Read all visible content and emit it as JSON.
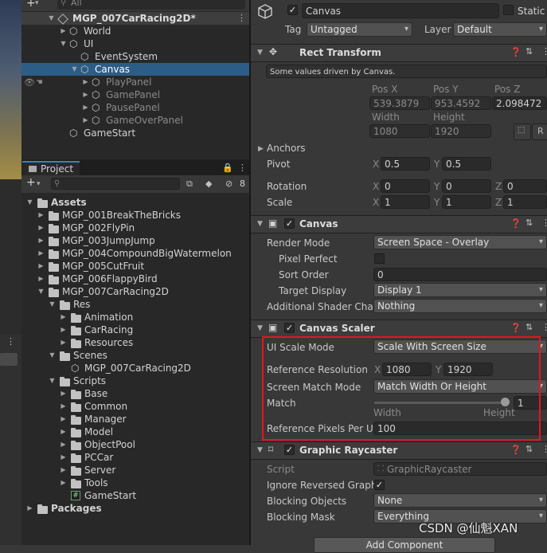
{
  "hierarchy": {
    "add_label": "+",
    "search_placeholder": "All",
    "scene_name": "MGP_007CarRacing2D*",
    "items": [
      {
        "label": "World"
      },
      {
        "label": "UI"
      },
      {
        "label": "EventSystem"
      },
      {
        "label": "Canvas"
      },
      {
        "label": "PlayPanel"
      },
      {
        "label": "GamePanel"
      },
      {
        "label": "PausePanel"
      },
      {
        "label": "GameOverPanel"
      },
      {
        "label": "GameStart"
      }
    ]
  },
  "project": {
    "tab_label": "Project",
    "add_label": "+",
    "hidden_count": "8",
    "tree": [
      {
        "label": "Assets"
      },
      {
        "label": "MGP_001BreakTheBricks"
      },
      {
        "label": "MGP_002FlyPin"
      },
      {
        "label": "MGP_003JumpJump"
      },
      {
        "label": "MGP_004CompoundBigWatermelon"
      },
      {
        "label": "MGP_005CutFruit"
      },
      {
        "label": "MGP_006FlappyBird"
      },
      {
        "label": "MGP_007CarRacing2D"
      },
      {
        "label": "Res"
      },
      {
        "label": "Animation"
      },
      {
        "label": "CarRacing"
      },
      {
        "label": "Resources"
      },
      {
        "label": "Scenes"
      },
      {
        "label": "MGP_007CarRacing2D"
      },
      {
        "label": "Scripts"
      },
      {
        "label": "Base"
      },
      {
        "label": "Common"
      },
      {
        "label": "Manager"
      },
      {
        "label": "Model"
      },
      {
        "label": "ObjectPool"
      },
      {
        "label": "PCCar"
      },
      {
        "label": "Server"
      },
      {
        "label": "Tools"
      },
      {
        "label": "GameStart"
      },
      {
        "label": "Packages"
      }
    ]
  },
  "inspector": {
    "object_name": "Canvas",
    "static_label": "Static",
    "tag_label": "Tag",
    "tag_value": "Untagged",
    "layer_label": "Layer",
    "layer_value": "Default",
    "rect_transform": {
      "title": "Rect Transform",
      "driven_note": "Some values driven by Canvas.",
      "posx_label": "Pos X",
      "posy_label": "Pos Y",
      "posz_label": "Pos Z",
      "posx": "539.3879",
      "posy": "953.4592",
      "posz": "2.098472",
      "width_label": "Width",
      "height_label": "Height",
      "width": "1080",
      "height": "1920",
      "r_button": "R",
      "anchors_label": "Anchors",
      "pivot_label": "Pivot",
      "pivot_x": "0.5",
      "pivot_y": "0.5",
      "rotation_label": "Rotation",
      "rot_x": "0",
      "rot_y": "0",
      "rot_z": "0",
      "scale_label": "Scale",
      "scale_x": "1",
      "scale_y": "1",
      "scale_z": "1",
      "x_label": "X",
      "y_label": "Y",
      "z_label": "Z"
    },
    "canvas": {
      "title": "Canvas",
      "render_mode_label": "Render Mode",
      "render_mode": "Screen Space - Overlay",
      "pixel_perfect_label": "Pixel Perfect",
      "sort_order_label": "Sort Order",
      "sort_order": "0",
      "target_display_label": "Target Display",
      "target_display": "Display 1",
      "shader_label": "Additional Shader Chan",
      "shader_value": "Nothing"
    },
    "canvas_scaler": {
      "title": "Canvas Scaler",
      "ui_scale_mode_label": "UI Scale Mode",
      "ui_scale_mode": "Scale With Screen Size",
      "ref_res_label": "Reference Resolution",
      "ref_x": "1080",
      "ref_y": "1920",
      "match_mode_label": "Screen Match Mode",
      "match_mode": "Match Width Or Height",
      "match_label": "Match",
      "match_value": "1",
      "match_fraction": 1,
      "width_caption": "Width",
      "height_caption": "Height",
      "ref_pixels_label": "Reference Pixels Per Ur",
      "ref_pixels": "100"
    },
    "graphic_raycaster": {
      "title": "Graphic Raycaster",
      "script_label": "Script",
      "script_value": "GraphicRaycaster",
      "ignore_label": "Ignore Reversed Graphi",
      "blocking_objects_label": "Blocking Objects",
      "blocking_objects": "None",
      "blocking_mask_label": "Blocking Mask",
      "blocking_mask": "Everything"
    },
    "add_component": "Add Component"
  },
  "watermark": "CSDN @仙魁XAN",
  "colors": {
    "selection": "#2c5d87",
    "highlight_box": "#e8141e",
    "panel_bg": "#383838",
    "tree_bg": "#282828"
  }
}
